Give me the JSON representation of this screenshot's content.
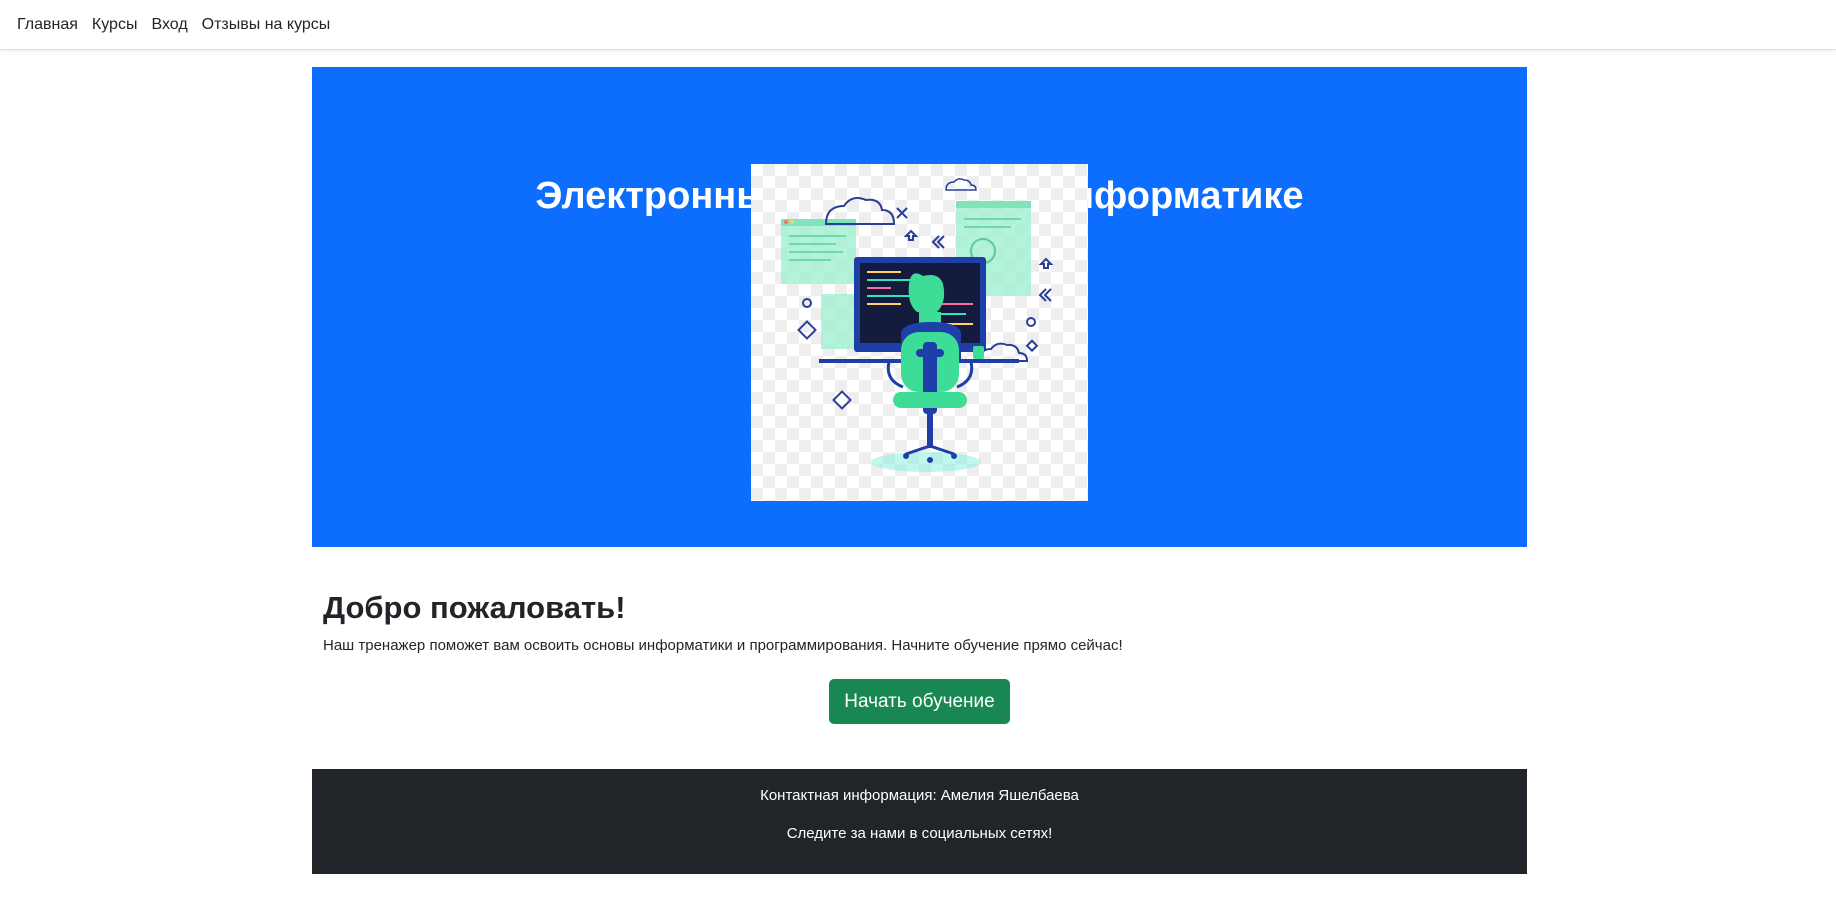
{
  "nav": {
    "items": [
      {
        "label": "Главная"
      },
      {
        "label": "Курсы"
      },
      {
        "label": "Вход"
      },
      {
        "label": "Отзывы на курсы"
      }
    ]
  },
  "hero": {
    "title": "Электронный тренажер по информатике",
    "background_color": "#0d6efd"
  },
  "welcome": {
    "title": "Добро пожаловать!",
    "text": "Наш тренажер поможет вам освоить основы информатики и программирования. Начните обучение прямо сейчас!",
    "button_label": "Начать обучение",
    "button_color": "#198754"
  },
  "footer": {
    "contact": "Контактная информация: Амелия Яшелбаева",
    "social": "Следите за нами в социальных сетях!",
    "background_color": "#212529"
  }
}
